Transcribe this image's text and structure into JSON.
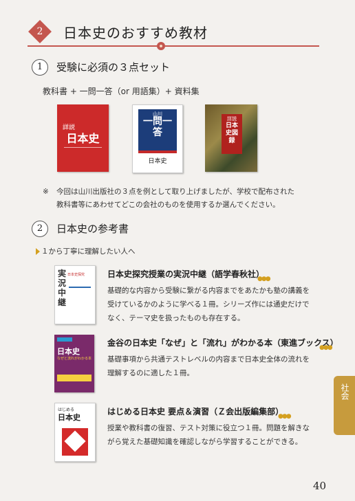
{
  "header": {
    "number": "2",
    "title": "日本史のおすすめ教材"
  },
  "section1": {
    "number": "1",
    "title": "受験に必須の３点セット",
    "summary": "教科書 + 一問一答（or 用語集）+ 資料集",
    "books": [
      {
        "name": "詳説日本史",
        "label_main": "日本史",
        "label_sub": "詳説"
      },
      {
        "name": "一問一答 日本史",
        "label_top": "山川",
        "label_main": "一問一答",
        "label_sub": "日本史"
      },
      {
        "name": "詳説日本史図録",
        "label_main": "日本史図録",
        "label_sub": "詳説"
      }
    ],
    "note_mark": "※",
    "note_line1": "今回は山川出版社の３点を例として取り上げましたが、学校で配布された",
    "note_line2": "教科書等にあわせてどこの会社のものを使用するか選んでください。"
  },
  "section2": {
    "number": "2",
    "title": "日本史の参考書",
    "subtitle": "１から丁寧に理解したい人へ",
    "items": [
      {
        "title": "日本史探究授業の実況中継（語学春秋社）",
        "desc_line1": "基礎的な内容から受験に繋がる内容までをあたかも塾の講義を",
        "desc_line2": "受けているかのように学べる１冊。シリーズ作には通史だけで",
        "desc_line3": "なく、テーマ史を扱ったものも存在する。",
        "cover_main": "実況中継",
        "cover_sub": "日本史探究"
      },
      {
        "title": "金谷の日本史「なぜ」と「流れ」がわかる本（東進ブックス）",
        "desc_line1": "基礎事項から共通テストレベルの内容まで日本史全体の流れを",
        "desc_line2": "理解するのに適した１冊。",
        "cover_main": "日本史",
        "cover_sub": "なぜと流れがわかる本"
      },
      {
        "title": "はじめる日本史 要点＆演習（Ｚ会出版編集部）",
        "desc_line1": "授業や教科書の復習、テスト対策に役立つ１冊。問題を解きな",
        "desc_line2": "がら覚えた基礎知識を確認しながら学習することができる。",
        "cover_main": "日本史",
        "cover_sub": "はじめる"
      }
    ]
  },
  "side_tab": "社会",
  "page_number": "40",
  "colors": {
    "accent": "#c4564e",
    "gold": "#c79b3d"
  }
}
